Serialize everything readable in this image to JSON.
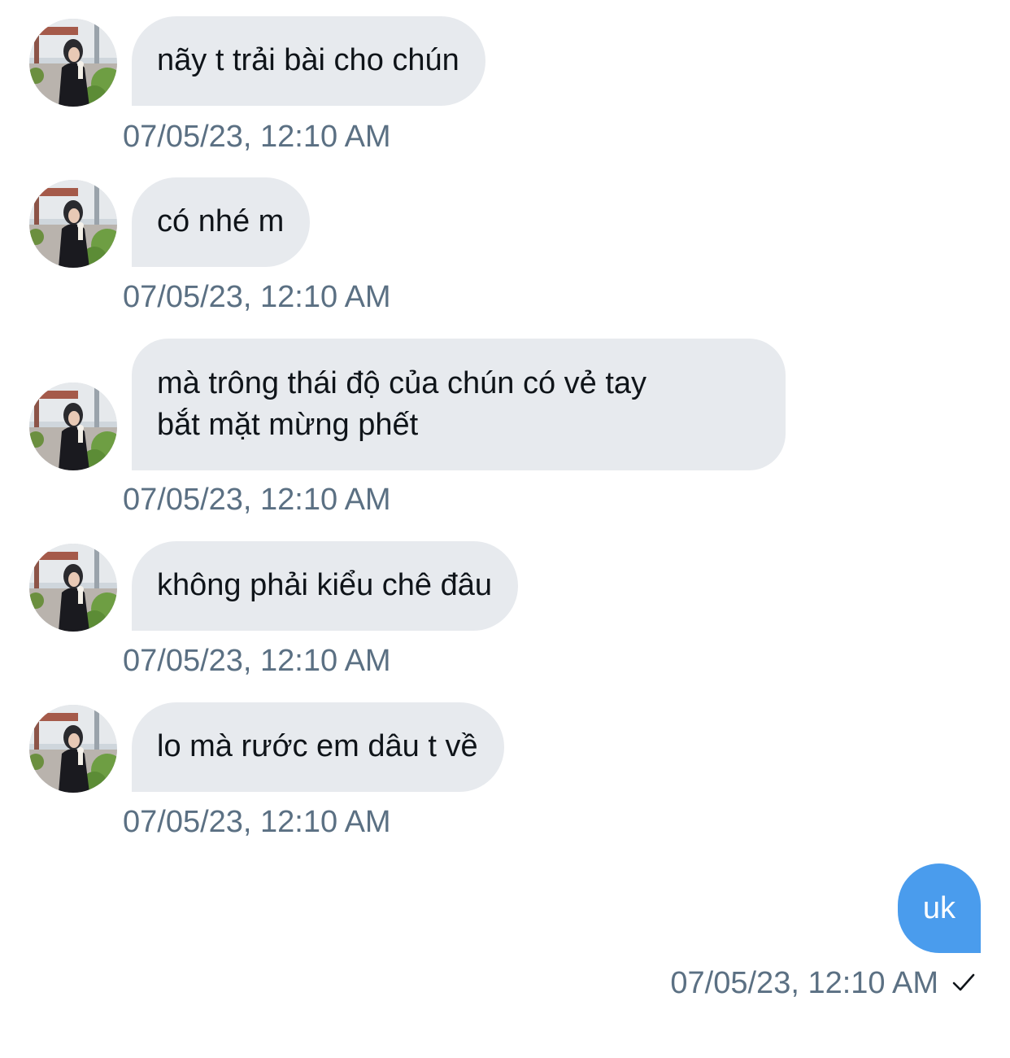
{
  "messages": [
    {
      "text": "nãy t trải bài cho chún",
      "time": "07/05/23, 12:10 AM",
      "avatar": "contact-avatar"
    },
    {
      "text": "có nhé m",
      "time": "07/05/23, 12:10 AM",
      "avatar": "contact-avatar"
    },
    {
      "text_line1": "mà trông thái độ của chún có vẻ tay",
      "text_line2": "bắt mặt mừng phết",
      "time": "07/05/23, 12:10 AM",
      "avatar": "contact-avatar"
    },
    {
      "text": "không phải kiểu chê đâu",
      "time": "07/05/23, 12:10 AM",
      "avatar": "contact-avatar"
    },
    {
      "text": "lo mà rước em dâu t về",
      "time": "07/05/23, 12:10 AM",
      "avatar": "contact-avatar"
    }
  ],
  "outgoing": {
    "text": "uk",
    "time": "07/05/23, 12:10 AM",
    "status_icon": "checkmark-icon"
  },
  "colors": {
    "incoming_bubble": "#e7eaee",
    "outgoing_bubble": "#4a9ced",
    "timestamp": "#5b7083"
  }
}
